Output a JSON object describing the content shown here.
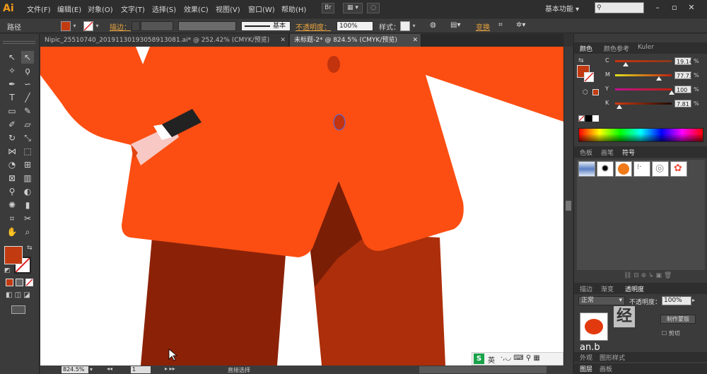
{
  "app": {
    "logo": "Ai"
  },
  "menu": [
    "文件(F)",
    "编辑(E)",
    "对象(O)",
    "文字(T)",
    "选择(S)",
    "效果(C)",
    "视图(V)",
    "窗口(W)",
    "帮助(H)"
  ],
  "menu_icons": {
    "bridge": "Br",
    "arrange": "arrange-documents-icon",
    "gpu": "gpu-icon"
  },
  "workspace": {
    "label": "基本功能",
    "search_placeholder": ""
  },
  "controlbar": {
    "selection_label": "路径",
    "stroke_label": "描边：",
    "stroke_style": "基本",
    "opacity_label": "不透明度：",
    "opacity_value": "100%",
    "style_label": "样式：",
    "transform_label": "变换",
    "fill_color": "#c23a10"
  },
  "tabs": [
    {
      "title": "Nipic_25510740_20191130193058913081.ai* @ 252.42% (CMYK/预览)",
      "active": false
    },
    {
      "title": "未标题-2* @ 824.5% (CMYK/预览)",
      "active": true
    }
  ],
  "status": {
    "zoom": "824.5%",
    "page": "1",
    "tool_name": "直接选择"
  },
  "color_panel": {
    "tabs": [
      "颜色",
      "颜色参考",
      "Kuler"
    ],
    "channels": [
      {
        "label": "C",
        "value": "19.14",
        "fraction": 0.19,
        "gradient": "linear-gradient(90deg,#c8320e,#8a3a1a)"
      },
      {
        "label": "M",
        "value": "77.73",
        "fraction": 0.78,
        "gradient": "linear-gradient(90deg,#e0e020,#c02010)"
      },
      {
        "label": "Y",
        "value": "100",
        "fraction": 1.0,
        "gradient": "linear-gradient(90deg,#c01090,#c02010)"
      },
      {
        "label": "K",
        "value": "7.81",
        "fraction": 0.08,
        "gradient": "linear-gradient(90deg,#d23a10,#200c05)"
      }
    ],
    "pct_sign": "%",
    "current_color": "#c23a10"
  },
  "brush_panel": {
    "tabs": [
      "色板",
      "画笔",
      "符号"
    ]
  },
  "transparency_panel": {
    "tabs": [
      "描边",
      "渐变",
      "透明度"
    ],
    "blend_mode": "正常",
    "opacity_label": "不透明度：",
    "opacity_value": "100%",
    "mask_button": "制作蒙版",
    "clip_label": "剪切"
  },
  "bottom_tabs": {
    "row1": [
      "外观",
      "图形样式"
    ],
    "row2": [
      "图层",
      "画板"
    ]
  },
  "ime": {
    "label": "英"
  },
  "watermark": {
    "text": "经",
    "sub": "an.b"
  },
  "artwork": {
    "jacket_color": "#fc4e12",
    "pants_left_color": "#8b2208",
    "pants_right_color": "#ac2e0a",
    "shadow_color": "#7a1e06",
    "button_color": "#c2330e",
    "pocket_color": "#f8c9c4",
    "pen_color": "#222222"
  }
}
